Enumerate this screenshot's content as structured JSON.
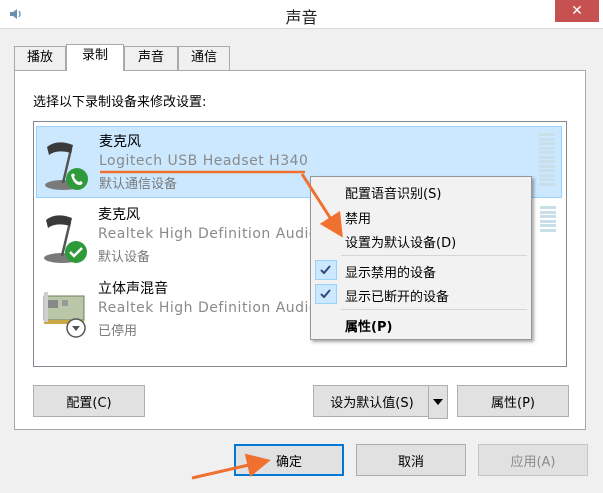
{
  "window": {
    "title": "声音",
    "close_glyph": "✕"
  },
  "tabs": [
    {
      "label": "播放"
    },
    {
      "label": "录制"
    },
    {
      "label": "声音"
    },
    {
      "label": "通信"
    }
  ],
  "panel": {
    "instruction": "选择以下录制设备来修改设置:"
  },
  "devices": [
    {
      "name": "麦克风",
      "description": "Logitech USB Headset H340",
      "status": "默认通信设备",
      "icon": "microphone-phone-icon"
    },
    {
      "name": "麦克风",
      "description": "Realtek High Definition Audio",
      "status": "默认设备",
      "icon": "microphone-check-icon"
    },
    {
      "name": "立体声混音",
      "description": "Realtek High Definition Audio",
      "status": "已停用",
      "icon": "sound-card-disabled-icon"
    }
  ],
  "buttons": {
    "configure": "配置(C)",
    "set_default": "设为默认值(S)",
    "properties": "属性(P)"
  },
  "context_menu": {
    "items": [
      "配置语音识别(S)",
      "禁用",
      "设置为默认设备(D)",
      "显示禁用的设备",
      "显示已断开的设备",
      "属性(P)"
    ]
  },
  "dialog_buttons": {
    "ok": "确定",
    "cancel": "取消",
    "apply": "应用(A)"
  },
  "colors": {
    "selection": "#cce8ff",
    "annotation": "#f07030",
    "close": "#c75050"
  }
}
